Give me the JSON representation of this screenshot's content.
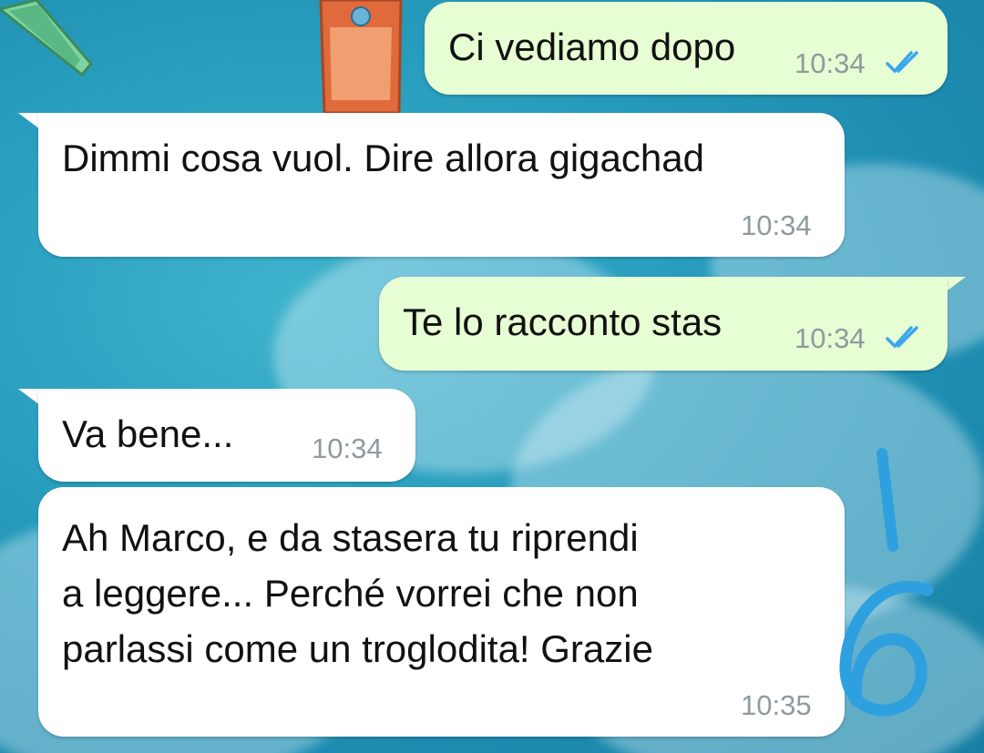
{
  "messages": [
    {
      "direction": "outgoing",
      "text": "Ci vediamo dopo",
      "time": "10:34",
      "read": true
    },
    {
      "direction": "incoming",
      "text": "Dimmi cosa vuol. Dire allora gigachad",
      "time": "10:34"
    },
    {
      "direction": "outgoing",
      "text": "Te lo racconto stas",
      "time": "10:34",
      "read": true
    },
    {
      "direction": "incoming",
      "text": "Va bene...",
      "time": "10:34"
    },
    {
      "direction": "incoming",
      "lines": [
        "Ah Marco, e da stasera tu riprendi",
        "a leggere... Perché vorrei che non",
        "parlassi come un troglodita! Grazie"
      ],
      "time": "10:35"
    }
  ],
  "annotation": {
    "text": "16",
    "color": "#2ea0e0"
  },
  "colors": {
    "outgoing_bubble": "#e7fdd3",
    "incoming_bubble": "#ffffff",
    "read_ticks": "#3aa6ee",
    "timestamp": "#8e9a9e"
  }
}
